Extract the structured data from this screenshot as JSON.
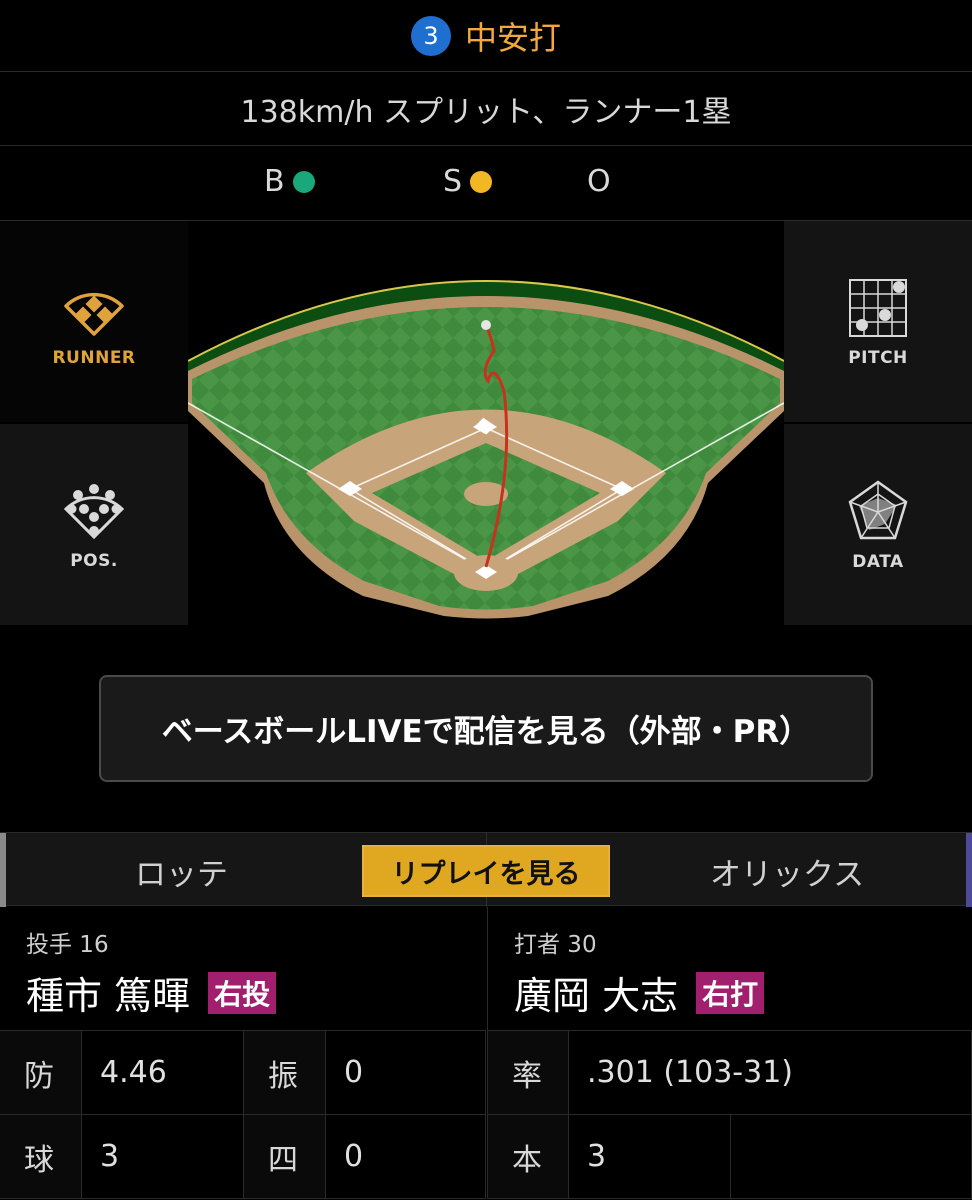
{
  "play": {
    "inning_number": "3",
    "result": "中安打",
    "detail": "138km/h スプリット、ランナー1塁"
  },
  "count": {
    "ball_label": "B",
    "strike_label": "S",
    "out_label": "O",
    "balls": 1,
    "strikes": 1,
    "outs": 0,
    "ball_color": "#1aa87a",
    "strike_color": "#f2b824"
  },
  "views": {
    "runner": "RUNNER",
    "pos": "POS.",
    "pitch": "PITCH",
    "data": "DATA",
    "active": "runner",
    "active_color": "#e0a33c"
  },
  "live_button": "ベースボールLIVEで配信を見る（外部・PR）",
  "teams": {
    "left": "ロッテ",
    "right": "オリックス",
    "replay": "リプレイを見る"
  },
  "pitcher": {
    "role": "投手 16",
    "name": "種市 篤暉",
    "hand": "右投",
    "stats": [
      {
        "label": "防",
        "value": "4.46"
      },
      {
        "label": "振",
        "value": "0"
      },
      {
        "label": "球",
        "value": "3"
      },
      {
        "label": "四",
        "value": "0"
      }
    ]
  },
  "batter": {
    "role": "打者 30",
    "name": "廣岡 大志",
    "hand": "右打",
    "stats": [
      {
        "label": "率",
        "value": ".301 (103-31)"
      },
      {
        "label": "本",
        "value": "3"
      }
    ]
  }
}
